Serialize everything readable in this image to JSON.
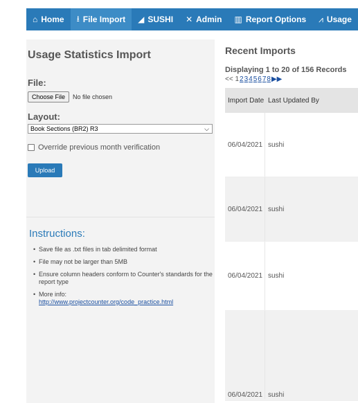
{
  "nav": {
    "items": [
      {
        "icon": "home-icon",
        "glyph": "⌂",
        "label": "Home"
      },
      {
        "icon": "upload-icon",
        "glyph": "⭳",
        "label": "File Import"
      },
      {
        "icon": "sushi-icon",
        "glyph": "◢",
        "label": "SUSHI"
      },
      {
        "icon": "tools-icon",
        "glyph": "✕",
        "label": "Admin"
      },
      {
        "icon": "bar-chart-icon",
        "glyph": "▥",
        "label": "Report Options"
      },
      {
        "icon": "line-chart-icon",
        "glyph": "⩘",
        "label": "Usage"
      }
    ],
    "accent": "#2a7ab8"
  },
  "import_form": {
    "title": "Usage Statistics Import",
    "file_label": "File:",
    "choose_button": "Choose File",
    "no_file_text": "No file chosen",
    "layout_label": "Layout:",
    "layout_selected": "Book Sections (BR2) R3",
    "override_label": "Override previous month verification",
    "upload_button": "Upload"
  },
  "instructions": {
    "title": "Instructions:",
    "items": [
      "Save file as .txt files in tab delimited format",
      "File may not be larger than 5MB",
      "Ensure column headers conform to Counter's standards for the report type",
      "More info:"
    ],
    "link": "http://www.projectcounter.org/code_practice.html"
  },
  "recent": {
    "title": "Recent Imports",
    "display_text": "Displaying 1 to 20 of 156 Records",
    "pager_prev": "<<",
    "current_page": "1",
    "pages": [
      "2",
      "3",
      "4",
      "5",
      "6",
      "7",
      "8"
    ],
    "pager_next": "▶▶",
    "headers": [
      "Import Date",
      "Last Updated By"
    ],
    "rows": [
      {
        "date": "06/04/2021",
        "user": "sushi"
      },
      {
        "date": "06/04/2021",
        "user": "sushi"
      },
      {
        "date": "06/04/2021",
        "user": "sushi"
      },
      {
        "date": "06/04/2021",
        "user": "sushi"
      }
    ]
  }
}
